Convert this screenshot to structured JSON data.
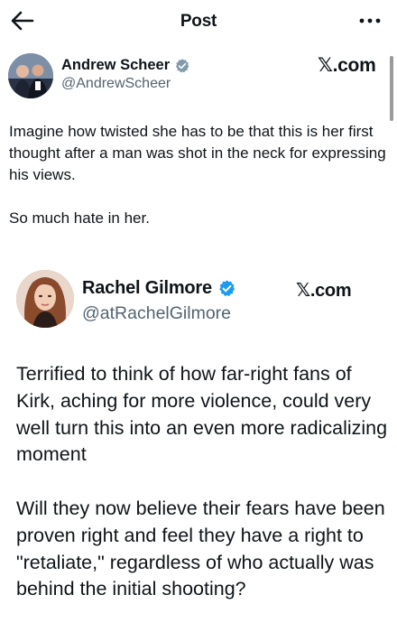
{
  "header": {
    "title": "Post",
    "back_icon": "arrow-left-icon",
    "more_icon": "more-horizontal-icon"
  },
  "post": {
    "author": {
      "name": "Andrew Scheer",
      "handle": "@AndrewScheer",
      "verified_color": "#829aab"
    },
    "brand": ".com",
    "body": "Imagine how twisted she has to be that this is her first thought after a man was shot in the neck for expressing his views.\n\nSo much hate in her."
  },
  "quoted": {
    "author": {
      "name": "Rachel Gilmore",
      "handle": "@atRachelGilmore",
      "verified_color": "#1d9bf0"
    },
    "brand": ".com",
    "body": "Terrified to think of how far-right fans of Kirk, aching for more violence, could very well turn this into an even more radicalizing moment\n\nWill they now believe their fears have been proven right and feel they have a right to \"retaliate,\" regardless of who actually was behind the initial shooting?"
  },
  "colors": {
    "text": "#0f1419",
    "secondary": "#536471",
    "background": "#ffffff"
  }
}
